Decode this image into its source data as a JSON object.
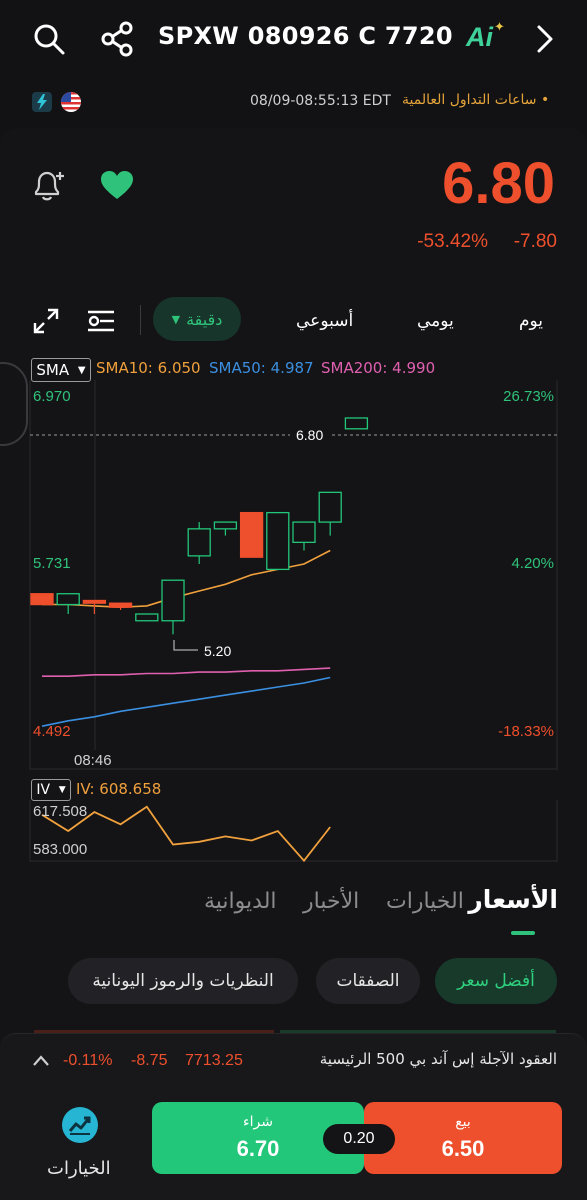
{
  "header": {
    "ticker": "SPXW 080926 C 7720",
    "ai_label": "Ai",
    "session": "ساعات التداول العالمية •",
    "timestamp": "08/09-08:55:13 EDT"
  },
  "quote": {
    "price": "6.80",
    "change": "-7.80",
    "change_pct": "-53.42%"
  },
  "timeframes": {
    "day": "يوم",
    "daily": "يومي",
    "weekly": "أسبوعي",
    "minute": "دقيقة"
  },
  "indicators": {
    "sma_selector": "SMA",
    "sma10": "SMA10: 6.050",
    "sma50": "SMA50: 4.987",
    "sma200": "SMA200: 4.990",
    "iv_selector": "IV",
    "iv_value": "IV: 608.658",
    "iv_high": "617.508",
    "iv_low": "583.000"
  },
  "chart_data": {
    "type": "candlestick",
    "y_axis_left": [
      "6.970",
      "5.731",
      "4.492"
    ],
    "y_axis_right": [
      "26.73%",
      "4.20%",
      "-18.33%"
    ],
    "ylim": [
      4.492,
      6.97
    ],
    "x_tick": "08:46",
    "last_price_label": "6.80",
    "low_marker_label": "5.20",
    "candles": [
      {
        "o": 5.5,
        "h": 5.5,
        "l": 5.42,
        "c": 5.42
      },
      {
        "o": 5.42,
        "h": 5.5,
        "l": 5.35,
        "c": 5.5
      },
      {
        "o": 5.45,
        "h": 5.45,
        "l": 5.35,
        "c": 5.43
      },
      {
        "o": 5.43,
        "h": 5.43,
        "l": 5.38,
        "c": 5.4
      },
      {
        "o": 5.3,
        "h": 5.35,
        "l": 5.3,
        "c": 5.35
      },
      {
        "o": 5.3,
        "h": 5.6,
        "l": 5.2,
        "c": 5.6
      },
      {
        "o": 5.78,
        "h": 6.03,
        "l": 5.72,
        "c": 5.98
      },
      {
        "o": 5.98,
        "h": 6.03,
        "l": 5.93,
        "c": 6.03
      },
      {
        "o": 6.1,
        "h": 6.1,
        "l": 5.77,
        "c": 5.77
      },
      {
        "o": 5.68,
        "h": 6.1,
        "l": 5.68,
        "c": 6.1
      },
      {
        "o": 5.88,
        "h": 6.03,
        "l": 5.82,
        "c": 6.03
      },
      {
        "o": 6.03,
        "h": 6.25,
        "l": 5.93,
        "c": 6.25
      },
      {
        "o": 6.72,
        "h": 6.8,
        "l": 6.72,
        "c": 6.8
      }
    ],
    "sma10_line": [
      5.42,
      5.42,
      5.41,
      5.4,
      5.41,
      5.47,
      5.52,
      5.57,
      5.64,
      5.68,
      5.72,
      5.82
    ],
    "sma50_line": [
      4.52,
      4.56,
      4.59,
      4.63,
      4.66,
      4.69,
      4.72,
      4.75,
      4.78,
      4.81,
      4.84,
      4.88
    ],
    "sma200_line": [
      4.89,
      4.89,
      4.9,
      4.9,
      4.91,
      4.91,
      4.92,
      4.92,
      4.93,
      4.93,
      4.94,
      4.95
    ],
    "iv_line": [
      612.0,
      600.0,
      614.0,
      605.0,
      618.0,
      590.0,
      592.0,
      596.0,
      593.0,
      600.0,
      578.0,
      603.0
    ],
    "iv_ylim": [
      580.0,
      620.0
    ]
  },
  "tabs": {
    "prices": "الأسعار",
    "options": "الخيارات",
    "news": "الأخبار",
    "journal": "الديوانية"
  },
  "chips": {
    "best_price": "أفضل سعر",
    "trades": "الصفقات",
    "greeks": "النظريات والرموز اليونانية"
  },
  "futures": {
    "name": "العقود الآجلة إس آند بي 500 الرئيسية",
    "price": "7713.25",
    "change": "-8.75",
    "change_pct": "-0.11%"
  },
  "trade": {
    "options_label": "الخيارات",
    "buy_label": "شراء",
    "buy_price": "6.70",
    "sell_label": "بيع",
    "sell_price": "6.50",
    "spread": "0.20"
  },
  "colors": {
    "up": "#22c77a",
    "down": "#ee4f2c",
    "sma10": "#f0a03c",
    "sma50": "#3b8fe0",
    "sma200": "#e060b0",
    "accent_session": "#e5a33b"
  }
}
